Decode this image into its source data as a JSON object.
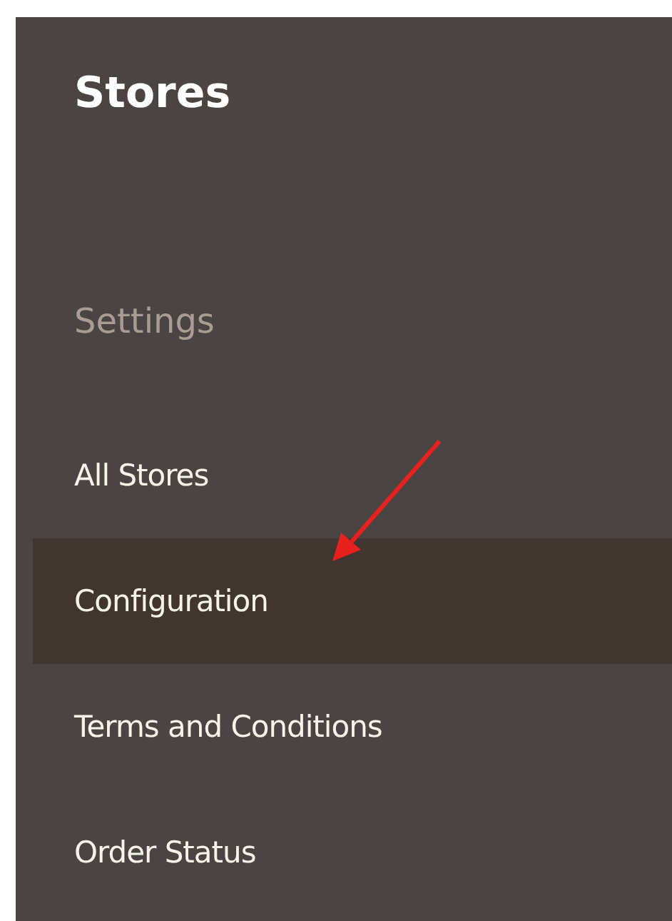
{
  "menu": {
    "title": "Stores",
    "section": "Settings",
    "items": [
      {
        "label": "All Stores",
        "selected": false
      },
      {
        "label": "Configuration",
        "selected": true
      },
      {
        "label": "Terms and Conditions",
        "selected": false
      },
      {
        "label": "Order Status",
        "selected": false
      }
    ]
  }
}
